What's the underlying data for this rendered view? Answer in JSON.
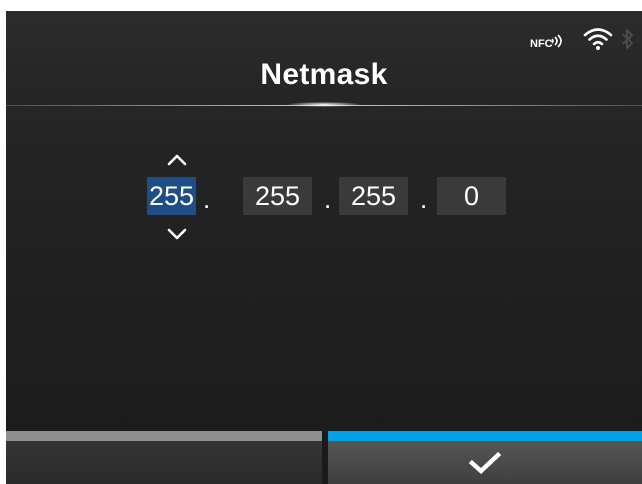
{
  "header": {
    "title": "Netmask",
    "status_icons": [
      "nfc-icon",
      "wifi-icon",
      "bluetooth-icon"
    ],
    "nfc_label": "NFC"
  },
  "netmask": {
    "octets": [
      "255",
      "255",
      "255",
      "0"
    ],
    "selected_octet": 1,
    "separator": "."
  },
  "footer": {
    "left_button_icon": "",
    "right_button_icon": "check-icon"
  },
  "colors": {
    "background": "#202020",
    "selected_field": "#1d4e86",
    "field": "#3a3a3a",
    "left_tab_indicator": "#8e8e8e",
    "right_tab_indicator": "#00a3e8",
    "text": "#ffffff"
  }
}
